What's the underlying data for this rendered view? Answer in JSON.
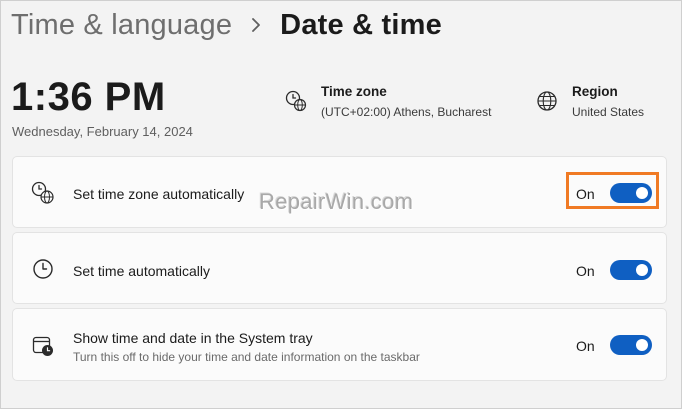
{
  "breadcrumb": {
    "parent": "Time & language",
    "current": "Date & time"
  },
  "clock": {
    "time": "1:36 PM",
    "date": "Wednesday, February 14, 2024"
  },
  "time_zone": {
    "title": "Time zone",
    "value": "(UTC+02:00) Athens, Bucharest",
    "icon": "globe-clock-icon"
  },
  "region": {
    "title": "Region",
    "value": "United States",
    "icon": "globe-icon"
  },
  "settings": [
    {
      "label": "Set time zone automatically",
      "state": "On",
      "icon": "time-zone-auto-icon",
      "highlighted": true
    },
    {
      "label": "Set time automatically",
      "state": "On",
      "icon": "clock-icon"
    },
    {
      "label": "Show time and date in the System tray",
      "sublabel": "Turn this off to hide your time and date information on the taskbar",
      "state": "On",
      "icon": "calendar-clock-icon"
    }
  ],
  "watermark": "RepairWin.com",
  "colors": {
    "accent": "#0f5fc2",
    "highlight": "#f07a24",
    "background": "#f3f3f3",
    "card": "#fbfbfb"
  }
}
